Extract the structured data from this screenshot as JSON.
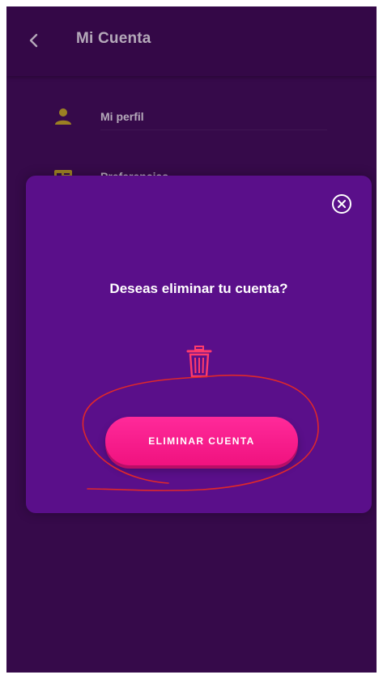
{
  "header": {
    "back_icon": "chevron-left-icon",
    "title": "Mi Cuenta"
  },
  "menu": {
    "items": [
      {
        "label": "Mi perfil",
        "icon": "user-icon"
      },
      {
        "label": "Preferencias",
        "icon": "id-card-icon"
      }
    ]
  },
  "dialog": {
    "close_icon": "close-circle-icon",
    "question": "Deseas eliminar tu cuenta?",
    "trash_icon": "trash-icon",
    "button_label": "ELIMINAR CUENTA"
  },
  "colors": {
    "background": "#3e0d55",
    "modal": "#5a0f8a",
    "accent_pink": "#ff2a9a",
    "icon_yellow": "#d9c21a",
    "trash_red": "#ff3b6b",
    "annotation_red": "#e0282a"
  }
}
